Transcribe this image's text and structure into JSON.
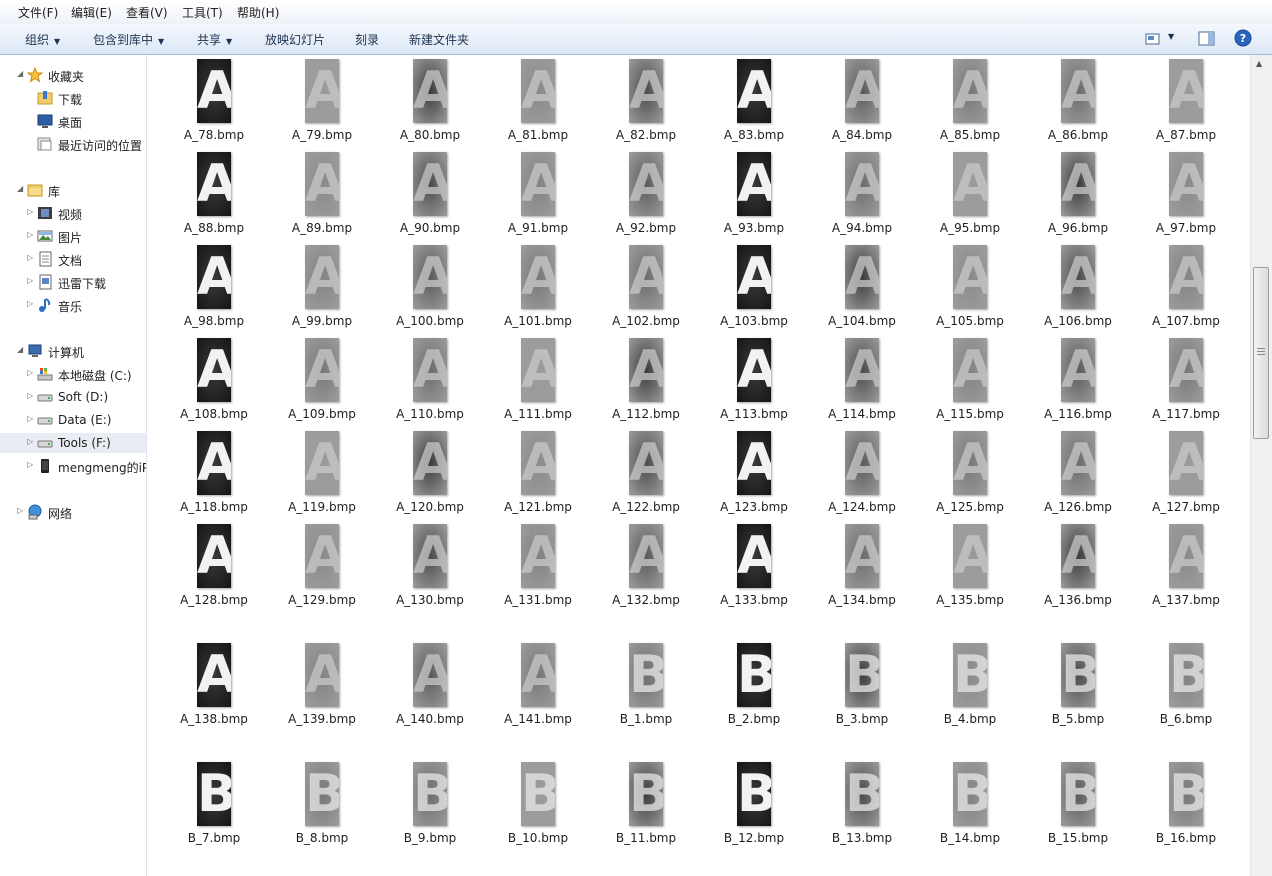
{
  "menu": [
    "文件(F)",
    "编辑(E)",
    "查看(V)",
    "工具(T)",
    "帮助(H)"
  ],
  "toolbar": {
    "organize": "组织",
    "include_in_library": "包含到库中",
    "share": "共享",
    "slideshow": "放映幻灯片",
    "burn": "刻录",
    "new_folder": "新建文件夹"
  },
  "nav": {
    "favorites": "收藏夹",
    "downloads": "下载",
    "desktop": "桌面",
    "recent": "最近访问的位置",
    "libraries": "库",
    "videos": "视频",
    "pictures": "图片",
    "documents": "文档",
    "thunder": "迅雷下载",
    "music": "音乐",
    "computer": "计算机",
    "drive_c": "本地磁盘 (C:)",
    "drive_d": "Soft (D:)",
    "drive_e": "Data (E:)",
    "drive_f": "Tools (F:)",
    "iphone": "mengmeng的iP",
    "network": "网络"
  },
  "files": [
    "A_78.bmp",
    "A_79.bmp",
    "A_80.bmp",
    "A_81.bmp",
    "A_82.bmp",
    "A_83.bmp",
    "A_84.bmp",
    "A_85.bmp",
    "A_86.bmp",
    "A_87.bmp",
    "A_88.bmp",
    "A_89.bmp",
    "A_90.bmp",
    "A_91.bmp",
    "A_92.bmp",
    "A_93.bmp",
    "A_94.bmp",
    "A_95.bmp",
    "A_96.bmp",
    "A_97.bmp",
    "A_98.bmp",
    "A_99.bmp",
    "A_100.bmp",
    "A_101.bmp",
    "A_102.bmp",
    "A_103.bmp",
    "A_104.bmp",
    "A_105.bmp",
    "A_106.bmp",
    "A_107.bmp",
    "A_108.bmp",
    "A_109.bmp",
    "A_110.bmp",
    "A_111.bmp",
    "A_112.bmp",
    "A_113.bmp",
    "A_114.bmp",
    "A_115.bmp",
    "A_116.bmp",
    "A_117.bmp",
    "A_118.bmp",
    "A_119.bmp",
    "A_120.bmp",
    "A_121.bmp",
    "A_122.bmp",
    "A_123.bmp",
    "A_124.bmp",
    "A_125.bmp",
    "A_126.bmp",
    "A_127.bmp",
    "A_128.bmp",
    "A_129.bmp",
    "A_130.bmp",
    "A_131.bmp",
    "A_132.bmp",
    "A_133.bmp",
    "A_134.bmp",
    "A_135.bmp",
    "A_136.bmp",
    "A_137.bmp",
    "A_138.bmp",
    "A_139.bmp",
    "A_140.bmp",
    "A_141.bmp",
    "B_1.bmp",
    "B_2.bmp",
    "B_3.bmp",
    "B_4.bmp",
    "B_5.bmp",
    "B_6.bmp",
    "B_7.bmp",
    "B_8.bmp",
    "B_9.bmp",
    "B_10.bmp",
    "B_11.bmp",
    "B_12.bmp",
    "B_13.bmp",
    "B_14.bmp",
    "B_15.bmp",
    "B_16.bmp"
  ],
  "colors": {
    "toolbar_bg": "#dce7f5",
    "nav_selected": "#e9edf3",
    "text": "#1e1e1e"
  }
}
